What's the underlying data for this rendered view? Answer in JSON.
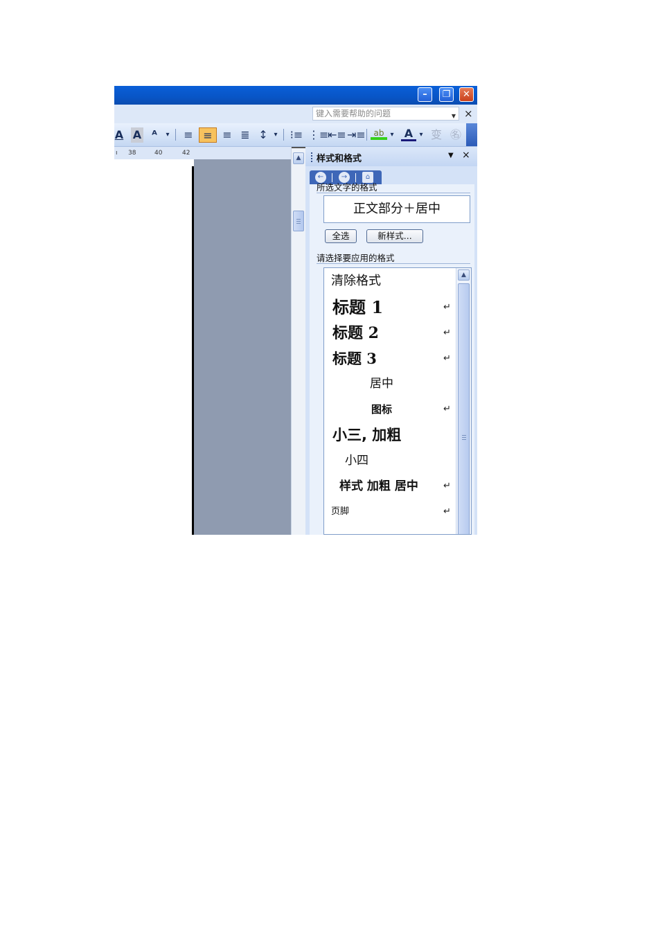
{
  "window": {
    "minimize_glyph": "–",
    "restore_glyph": "❐",
    "close_glyph": "✕"
  },
  "help": {
    "placeholder": "键入需要帮助的问题",
    "dropdown_glyph": "▼",
    "close_glyph": "×"
  },
  "toolbar": {
    "items": [
      "A",
      "A",
      "ᴬ",
      "▾",
      "≡",
      "≡",
      "≡",
      "≣",
      "↕",
      "▾",
      "⁝≡",
      "⋮≡",
      "⇤≡",
      "⇥≡",
      "ab",
      "▾",
      "A",
      "▾",
      "变",
      "㊔"
    ],
    "active_item": "center-align",
    "highlight_color": "#f7c25e"
  },
  "ruler": {
    "ticks": [
      "38",
      "40",
      "42"
    ]
  },
  "pane": {
    "title": "样式和格式",
    "menu_glyph": "▼",
    "close_glyph": "×",
    "nav": {
      "back": "←",
      "forward": "→",
      "home": "⌂"
    },
    "selected_section": "所选文字的格式",
    "current_format": "正文部分＋居中",
    "select_all_label": "全选",
    "new_style_label": "新样式...",
    "apply_section": "请选择要应用的格式",
    "styles": [
      {
        "name": "清除格式",
        "return": ""
      },
      {
        "name": "标题 1",
        "return": "↵"
      },
      {
        "name": "标题 2",
        "return": "↵"
      },
      {
        "name": "标题 3",
        "return": "↵"
      },
      {
        "name": "居中",
        "return": ""
      },
      {
        "name": "图标",
        "return": "↵"
      },
      {
        "name": "小三, 加粗",
        "return": ""
      },
      {
        "name": "小四",
        "return": ""
      },
      {
        "name": "样式 加粗 居中",
        "return": "↵"
      },
      {
        "name": "页脚",
        "return": "↵"
      }
    ]
  },
  "colors": {
    "titlebar": "#0855c6",
    "document_gray": "#8f9bb0",
    "pane_background": "#d4e2f7"
  }
}
